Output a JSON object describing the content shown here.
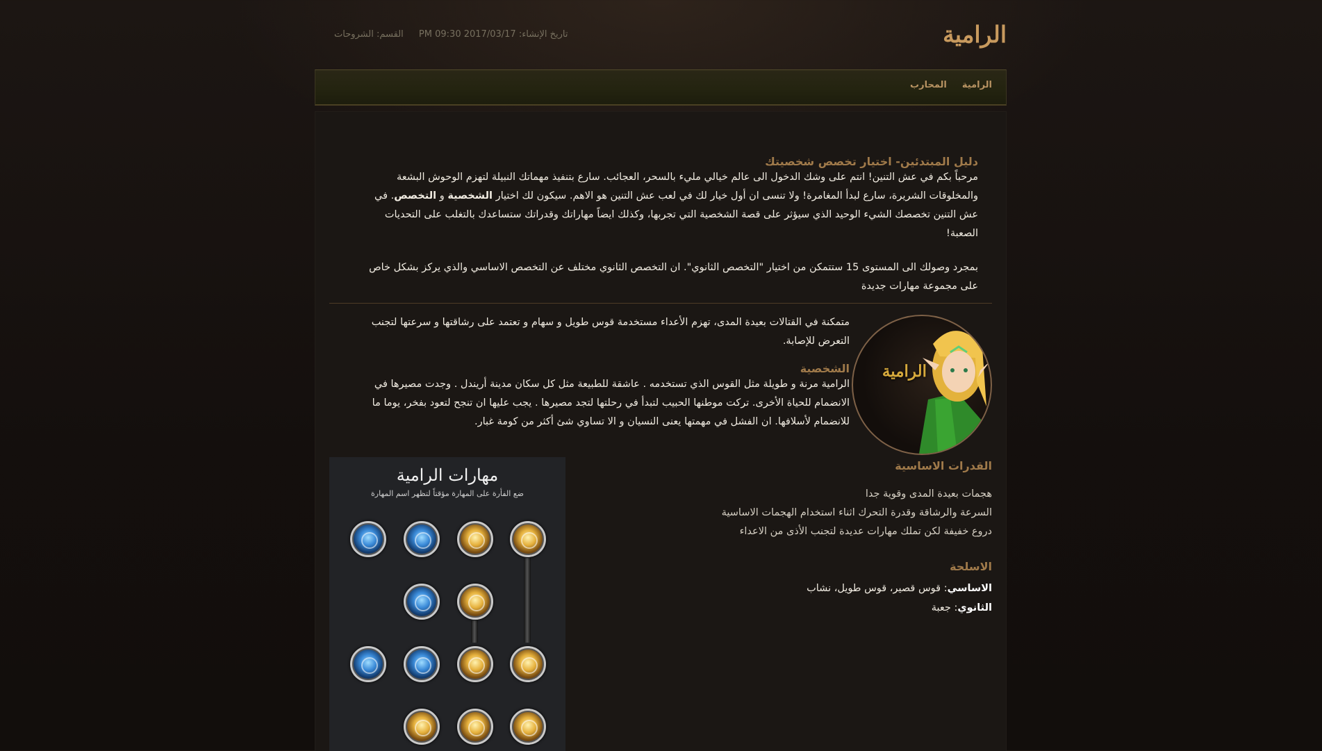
{
  "header": {
    "title": "الرامية",
    "created_label": "تاريخ الإنشاء:",
    "created_value": "2017/03/17 09:30 PM",
    "section_label": "القسم:",
    "section_value": "الشروحات"
  },
  "nav": {
    "items": [
      {
        "label": "الرامية"
      },
      {
        "label": "المحارب"
      }
    ]
  },
  "intro": {
    "heading": "دليل المبتدئين- اختيار تخصص شخصيتك",
    "p1_part1": "مرحباً بكم في عش التنين! انتم على وشك الدخول الى عالم خيالي مليء بالسحر، العجائب. سارع بتنفيذ مهماتك النبيلة لتهزم الوحوش البشعة والمخلوقات الشريرة، سارع لبدأ المغامرة! ولا تنسى ان أول خيار لك في لعب عش التنين هو الاهم. سيكون لك اختيار ",
    "p1_bold1": "الشخصية",
    "p1_and": " و ",
    "p1_bold2": "التخصص",
    "p1_part2": ". في عش التنين تخصصك الشيء الوحيد الذي سيؤثر على قصة الشخصية التي تجربها، وكذلك ايضاً مهاراتك وقدراتك ستساعدك بالتغلب على التحديات الصعبة!",
    "p2": "بمجرد وصولك الى المستوى 15 ستتمكن من اختيار \"التخصص الثانوي\". ان التخصص الثانوي مختلف عن التخصص الاساسي والذي يركز بشكل خاص على مجموعة مهارات جديدة"
  },
  "character": {
    "portrait_label": "الرامية",
    "description": "متمكنة في القتالات بعيدة المدى، تهزم الأعداء مستخدمة قوس طويل و سهام و تعتمد على رشاقتها و سرعتها لتجنب التعرض للإصابة.",
    "personality_heading": "الشخصية",
    "personality_text": "الرامية مرنة و طويلة مثل القوس الذي تستخدمه . عاشقة للطبيعة مثل كل سكان مدينة أريندل . وجدت مصيرها في الانضمام للحياة الأخرى. تركت موطنها الحبيب لتبدأ في رحلتها لتجد مصيرها . يجب عليها ان تنجح لتعود بفخر، يوما ما للانضمام لأسلافها. ان الفشل في مهمتها يعنى النسيان و الا تساوي شئ أكثر من كومة غبار."
  },
  "abilities": {
    "heading": "القدرات الاساسية",
    "items": [
      "هجمات بعيدة المدى وقوية جدا",
      "السرعة والرشاقة وقدرة التحرك اثناء استخدام الهجمات الاساسية",
      "دروع خفيفة لكن تملك مهارات عديدة لتجنب الأذى من الاعداء"
    ]
  },
  "weapons": {
    "heading": "الاسلحة",
    "primary_label": "الاساسي",
    "primary_value": ": قوس قصير، قوس طويل، نشاب",
    "secondary_label": "الثانوي",
    "secondary_value": ": جعبة"
  },
  "skills": {
    "title": "مهارات الرامية",
    "hint": "ضع الفأرة على المهارة مؤقتاً لتظهر اسم المهارة",
    "icons": [
      {
        "name": "skill-1",
        "color": "blue"
      },
      {
        "name": "skill-2",
        "color": "blue"
      },
      {
        "name": "skill-3",
        "color": "gold"
      },
      {
        "name": "skill-4",
        "color": "gold"
      },
      {
        "name": "skill-5",
        "color": "blue"
      },
      {
        "name": "skill-6",
        "color": "gold"
      },
      {
        "name": "skill-7",
        "color": "blue"
      },
      {
        "name": "skill-8",
        "color": "blue"
      },
      {
        "name": "skill-9",
        "color": "gold"
      },
      {
        "name": "skill-10",
        "color": "gold"
      },
      {
        "name": "skill-11",
        "color": "gold"
      },
      {
        "name": "skill-12",
        "color": "gold"
      },
      {
        "name": "skill-13",
        "color": "gold"
      }
    ]
  },
  "colors": {
    "accent": "#c89a5e",
    "heading": "#a07a4a",
    "background": "#140f0d",
    "panel": "#1b1714"
  }
}
